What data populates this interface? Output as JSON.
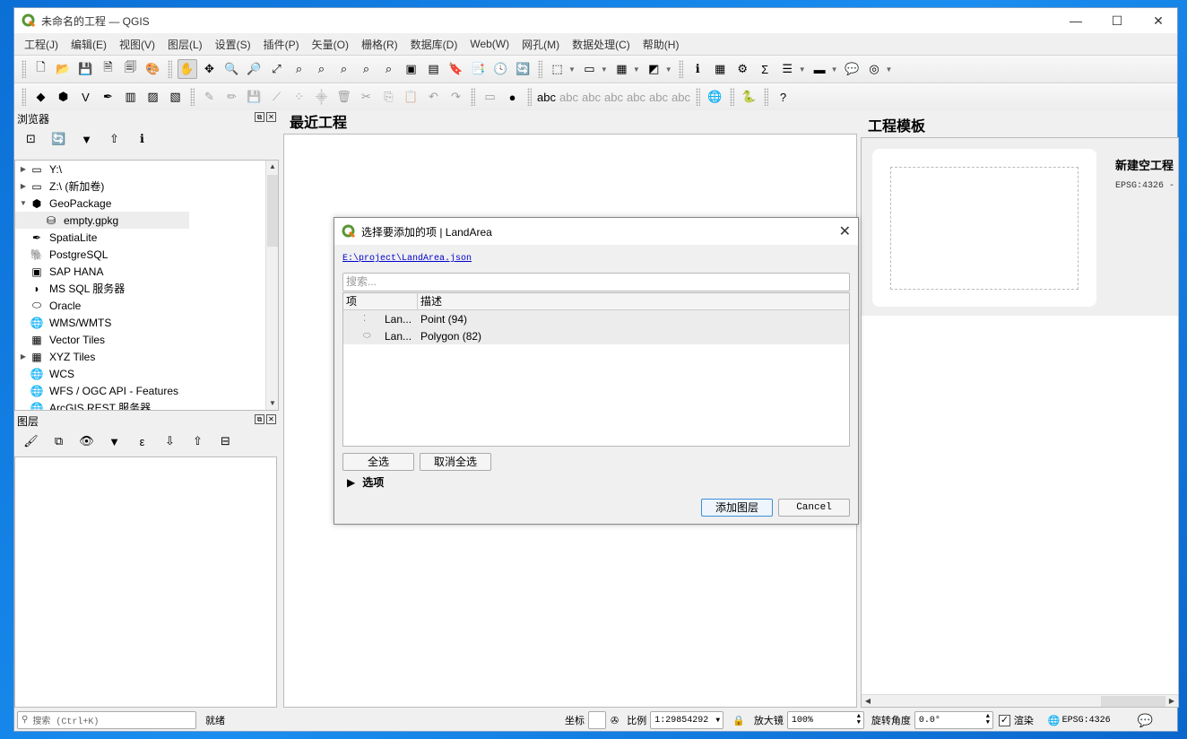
{
  "window": {
    "title": "未命名的工程 — QGIS",
    "controls": {
      "minimize": "—",
      "maximize": "☐",
      "close": "✕"
    }
  },
  "menubar": [
    "工程(J)",
    "编辑(E)",
    "视图(V)",
    "图层(L)",
    "设置(S)",
    "插件(P)",
    "矢量(O)",
    "栅格(R)",
    "数据库(D)",
    "Web(W)",
    "网孔(M)",
    "数据处理(C)",
    "帮助(H)"
  ],
  "toolbar1": [
    {
      "name": "new-project-icon",
      "glyph": "🗋"
    },
    {
      "name": "open-project-icon",
      "glyph": "📂"
    },
    {
      "name": "save-project-icon",
      "glyph": "💾"
    },
    {
      "name": "new-print-layout-icon",
      "glyph": "🗎"
    },
    {
      "name": "layout-manager-icon",
      "glyph": "🗐"
    },
    {
      "name": "style-manager-icon",
      "glyph": "🎨"
    },
    {
      "name": "pan-icon",
      "glyph": "✋"
    },
    {
      "name": "pan-to-selection-icon",
      "glyph": "✥"
    },
    {
      "name": "zoom-in-icon",
      "glyph": "🔍"
    },
    {
      "name": "zoom-out-icon",
      "glyph": "🔎"
    },
    {
      "name": "zoom-full-icon",
      "glyph": "⤢"
    },
    {
      "name": "zoom-selection-icon",
      "glyph": "⌕"
    },
    {
      "name": "zoom-layer-icon",
      "glyph": "⌕"
    },
    {
      "name": "zoom-native-icon",
      "glyph": "⌕"
    },
    {
      "name": "zoom-last-icon",
      "glyph": "⌕"
    },
    {
      "name": "zoom-next-icon",
      "glyph": "⌕"
    },
    {
      "name": "new-map-view-icon",
      "glyph": "▣"
    },
    {
      "name": "new-3d-map-view-icon",
      "glyph": "▤"
    },
    {
      "name": "new-bookmark-icon",
      "glyph": "🔖"
    },
    {
      "name": "show-bookmarks-icon",
      "glyph": "📑"
    },
    {
      "name": "temporal-controller-icon",
      "glyph": "🕓"
    },
    {
      "name": "refresh-icon",
      "glyph": "🔄"
    }
  ],
  "toolbar1_right": [
    {
      "name": "select-features-icon",
      "glyph": "⬚",
      "dd": true
    },
    {
      "name": "deselect-icon",
      "glyph": "▭",
      "dd": true
    },
    {
      "name": "select-by-expression-icon",
      "glyph": "▦",
      "dd": true
    },
    {
      "name": "select-location-icon",
      "glyph": "◩",
      "dd": true
    },
    {
      "name": "identify-icon",
      "glyph": "ℹ"
    },
    {
      "name": "attribute-table-icon",
      "glyph": "▦"
    },
    {
      "name": "processing-toolbox-icon",
      "glyph": "⚙"
    },
    {
      "name": "statistics-icon",
      "glyph": "Σ"
    },
    {
      "name": "field-calculator-icon",
      "glyph": "☰",
      "dd": true
    },
    {
      "name": "measure-icon",
      "glyph": "▬",
      "dd": true
    },
    {
      "name": "map-tips-icon",
      "glyph": "💬"
    },
    {
      "name": "locator-icon",
      "glyph": "◎",
      "dd": true
    }
  ],
  "toolbar2": [
    {
      "name": "data-source-manager-icon",
      "glyph": "◆"
    },
    {
      "name": "new-geopackage-layer-icon",
      "glyph": "⬢"
    },
    {
      "name": "new-shapefile-layer-icon",
      "glyph": "V"
    },
    {
      "name": "new-spatialite-layer-icon",
      "glyph": "✒"
    },
    {
      "name": "new-temporary-layer-icon",
      "glyph": "▥"
    },
    {
      "name": "new-virtual-layer-icon",
      "glyph": "▨"
    },
    {
      "name": "new-vector-tile-icon",
      "glyph": "▧"
    },
    {
      "name": "current-edits-icon",
      "glyph": "✎"
    },
    {
      "name": "toggle-editing-icon",
      "glyph": "✏"
    },
    {
      "name": "save-edits-icon",
      "glyph": "💾"
    },
    {
      "name": "digitize-line-icon",
      "glyph": "⟋"
    },
    {
      "name": "vertex-tool-icon",
      "glyph": "⁘"
    },
    {
      "name": "modify-attributes-icon",
      "glyph": "⸎"
    },
    {
      "name": "delete-selected-icon",
      "glyph": "🗑"
    },
    {
      "name": "cut-features-icon",
      "glyph": "✂"
    },
    {
      "name": "copy-features-icon",
      "glyph": "⎘"
    },
    {
      "name": "paste-features-icon",
      "glyph": "📋"
    },
    {
      "name": "undo-icon",
      "glyph": "↶"
    },
    {
      "name": "redo-icon",
      "glyph": "↷"
    },
    {
      "name": "label-toolbar-icon",
      "glyph": "▭"
    },
    {
      "name": "label-pin-icon",
      "glyph": "●"
    },
    {
      "name": "layer-labeling-icon",
      "glyph": "abc"
    },
    {
      "name": "layer-diagram-icon",
      "glyph": "abc"
    },
    {
      "name": "pin-label-icon",
      "glyph": "abc"
    },
    {
      "name": "show-hide-label-icon",
      "glyph": "abc"
    },
    {
      "name": "move-label-icon",
      "glyph": "abc"
    },
    {
      "name": "rotate-label-icon",
      "glyph": "abc"
    },
    {
      "name": "change-label-icon",
      "glyph": "abc"
    },
    {
      "name": "metasearch-icon",
      "glyph": "🌐"
    },
    {
      "name": "python-console-icon",
      "glyph": "🐍"
    },
    {
      "name": "help-icon",
      "glyph": "?"
    }
  ],
  "browser_panel": {
    "title": "浏览器",
    "tools": [
      {
        "name": "add-selected-layers-icon",
        "glyph": "⊡"
      },
      {
        "name": "refresh-icon",
        "glyph": "🔄"
      },
      {
        "name": "filter-icon",
        "glyph": "▼"
      },
      {
        "name": "collapse-all-icon",
        "glyph": "⇧"
      },
      {
        "name": "properties-icon",
        "glyph": "ℹ"
      }
    ],
    "items": [
      {
        "label": "Y:\\",
        "icon": "folder-icon",
        "glyph": "▭",
        "arrow": "▶",
        "indent": 0
      },
      {
        "label": "Z:\\ (新加卷)",
        "icon": "folder-icon",
        "glyph": "▭",
        "arrow": "▶",
        "indent": 0
      },
      {
        "label": "GeoPackage",
        "icon": "geopackage-icon",
        "glyph": "⬢",
        "arrow": "▼",
        "indent": 0
      },
      {
        "label": "empty.gpkg",
        "icon": "database-icon",
        "glyph": "⛁",
        "arrow": "",
        "indent": 1,
        "selected": true
      },
      {
        "label": "SpatiaLite",
        "icon": "spatialite-icon",
        "glyph": "✒",
        "arrow": "",
        "indent": 0
      },
      {
        "label": "PostgreSQL",
        "icon": "postgresql-icon",
        "glyph": "🐘",
        "arrow": "",
        "indent": 0
      },
      {
        "label": "SAP HANA",
        "icon": "sap-hana-icon",
        "glyph": "▣",
        "arrow": "",
        "indent": 0
      },
      {
        "label": "MS SQL 服务器",
        "icon": "mssql-icon",
        "glyph": "◗",
        "arrow": "",
        "indent": 0
      },
      {
        "label": "Oracle",
        "icon": "oracle-icon",
        "glyph": "⬭",
        "arrow": "",
        "indent": 0
      },
      {
        "label": "WMS/WMTS",
        "icon": "wms-icon",
        "glyph": "🌐",
        "arrow": "",
        "indent": 0
      },
      {
        "label": "Vector Tiles",
        "icon": "vector-tiles-icon",
        "glyph": "▦",
        "arrow": "",
        "indent": 0
      },
      {
        "label": "XYZ Tiles",
        "icon": "xyz-tiles-icon",
        "glyph": "▦",
        "arrow": "▶",
        "indent": 0
      },
      {
        "label": "WCS",
        "icon": "wcs-icon",
        "glyph": "🌐",
        "arrow": "",
        "indent": 0
      },
      {
        "label": "WFS / OGC API - Features",
        "icon": "wfs-icon",
        "glyph": "🌐",
        "arrow": "",
        "indent": 0
      },
      {
        "label": "ArcGIS REST 服务器",
        "icon": "arcgis-icon",
        "glyph": "🌐",
        "arrow": "",
        "indent": 0
      }
    ]
  },
  "layers_panel": {
    "title": "图层",
    "tools": [
      {
        "name": "layer-styling-icon",
        "glyph": "🖌"
      },
      {
        "name": "add-group-icon",
        "glyph": "⧉"
      },
      {
        "name": "manage-visibility-icon",
        "glyph": "👁"
      },
      {
        "name": "filter-legend-icon",
        "glyph": "▼"
      },
      {
        "name": "filter-expression-icon",
        "glyph": "ε"
      },
      {
        "name": "expand-all-icon",
        "glyph": "⇩"
      },
      {
        "name": "collapse-all-icon",
        "glyph": "⇧"
      },
      {
        "name": "remove-layer-icon",
        "glyph": "⊟"
      }
    ]
  },
  "welcome": {
    "recent_title": "最近工程",
    "templates_title": "工程模板",
    "template": {
      "name": "新建空工程",
      "crs": "EPSG:4326 -"
    }
  },
  "dialog": {
    "title": "选择要添加的项 | LandArea",
    "file_link": "E:\\project\\LandArea.json",
    "search_placeholder": "搜索...",
    "columns": [
      "项",
      "描述"
    ],
    "rows": [
      {
        "item": "Lan...",
        "description": "Point (94)",
        "icon": "point-layer-icon",
        "glyph": "⁚"
      },
      {
        "item": "Lan...",
        "description": "Polygon (82)",
        "icon": "polygon-layer-icon",
        "glyph": "⬭"
      }
    ],
    "select_all": "全选",
    "deselect_all": "取消全选",
    "options_label": "选项",
    "add_button": "添加图层",
    "cancel_button": "Cancel"
  },
  "statusbar": {
    "search_placeholder": "搜索 (Ctrl+K)",
    "status": "就绪",
    "coord_label": "坐标",
    "coord_value": "",
    "scale_label": "比例",
    "scale_value": "1:29854292",
    "magnifier_label": "放大镜",
    "magnifier_value": "100%",
    "rotation_label": "旋转角度",
    "rotation_value": "0.0°",
    "render_label": "渲染",
    "render_checked": true,
    "crs": "EPSG:4326"
  }
}
